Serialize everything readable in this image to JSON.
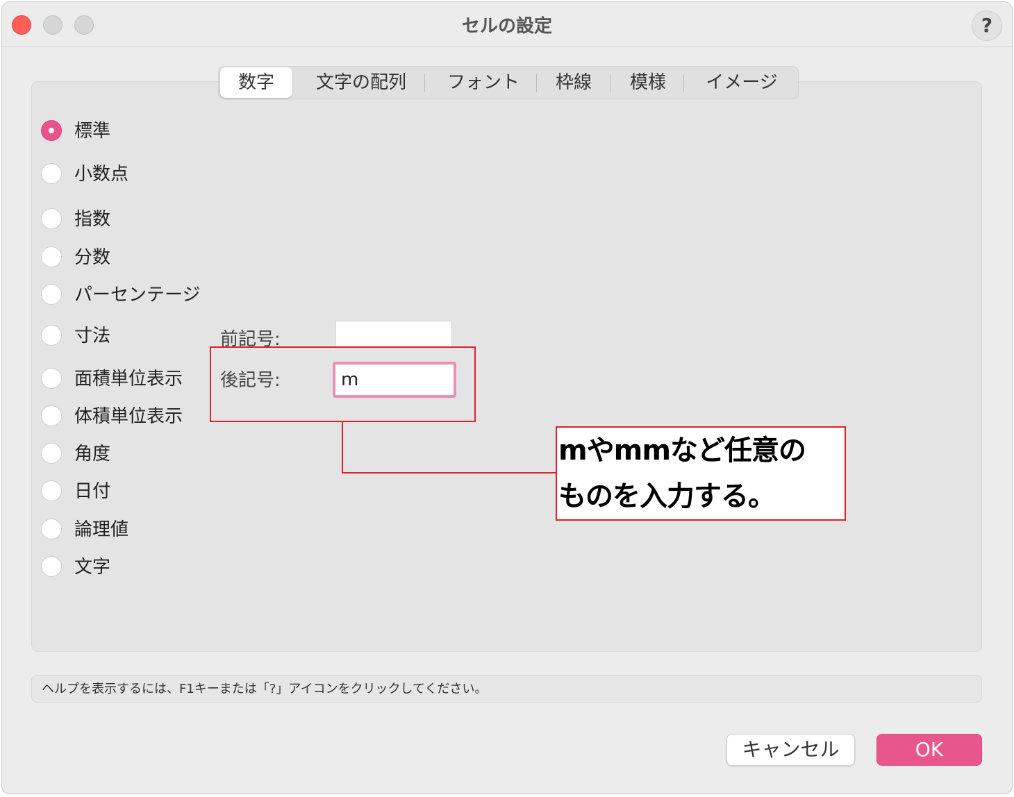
{
  "window": {
    "title": "セルの設定",
    "help_label": "?"
  },
  "tabs": [
    {
      "label": "数字",
      "active": true
    },
    {
      "label": "文字の配列",
      "active": false
    },
    {
      "label": "フォント",
      "active": false
    },
    {
      "label": "枠線",
      "active": false
    },
    {
      "label": "模様",
      "active": false
    },
    {
      "label": "イメージ",
      "active": false
    }
  ],
  "formats": [
    {
      "label": "標準",
      "checked": true
    },
    {
      "label": "小数点",
      "checked": false
    },
    {
      "label": "指数",
      "checked": false
    },
    {
      "label": "分数",
      "checked": false
    },
    {
      "label": "パーセンテージ",
      "checked": false
    },
    {
      "label": "寸法",
      "checked": false
    },
    {
      "label": "面積単位表示",
      "checked": false
    },
    {
      "label": "体積単位表示",
      "checked": false
    },
    {
      "label": "角度",
      "checked": false
    },
    {
      "label": "日付",
      "checked": false
    },
    {
      "label": "論理値",
      "checked": false
    },
    {
      "label": "文字",
      "checked": false
    }
  ],
  "dimension": {
    "prefix_label": "前記号:",
    "prefix_value": "",
    "suffix_label": "後記号:",
    "suffix_value": "m"
  },
  "annotation": {
    "line1": "mやmmなど任意の",
    "line2": "ものを入力する。",
    "color": "#e0202a"
  },
  "help_text": "ヘルプを表示するには、F1キーまたは「?」アイコンをクリックしてください。",
  "buttons": {
    "cancel": "キャンセル",
    "ok": "OK"
  },
  "colors": {
    "accent": "#e8568b",
    "close": "#fe5f57"
  }
}
